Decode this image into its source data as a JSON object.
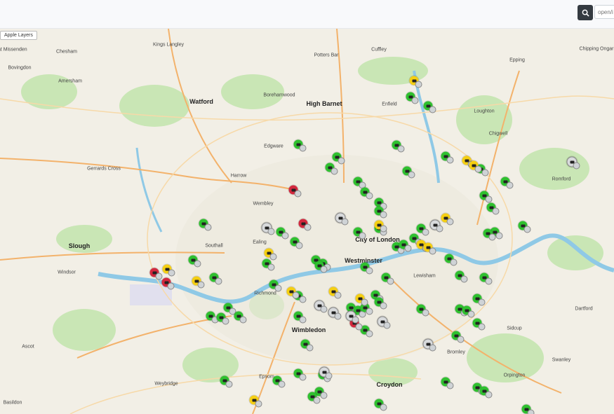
{
  "toolbar": {
    "search_placeholder": "open/i"
  },
  "map": {
    "layers_label": "Apple Layers",
    "places": [
      {
        "name": "Great Missenden"
      },
      {
        "name": "Chesham"
      },
      {
        "name": "Kings Langley"
      },
      {
        "name": "Bovingdon"
      },
      {
        "name": "Potters Bar"
      },
      {
        "name": "Cuffley"
      },
      {
        "name": "Epping"
      },
      {
        "name": "Chipping Ongar"
      },
      {
        "name": "Amersham"
      },
      {
        "name": "Watford"
      },
      {
        "name": "High Barnet"
      },
      {
        "name": "Enfield"
      },
      {
        "name": "Loughton"
      },
      {
        "name": "Chigwell"
      },
      {
        "name": "Borehamwood"
      },
      {
        "name": "Edgware"
      },
      {
        "name": "Gerrards Cross"
      },
      {
        "name": "Harrow"
      },
      {
        "name": "Wembley"
      },
      {
        "name": "Romford"
      },
      {
        "name": "Slough"
      },
      {
        "name": "Southall"
      },
      {
        "name": "Ealing"
      },
      {
        "name": "Westminster"
      },
      {
        "name": "City of London"
      },
      {
        "name": "Windsor"
      },
      {
        "name": "Richmond"
      },
      {
        "name": "Lewisham"
      },
      {
        "name": "Dartford"
      },
      {
        "name": "Wimbledon"
      },
      {
        "name": "Sidcup"
      },
      {
        "name": "Orpington"
      },
      {
        "name": "Croydon"
      },
      {
        "name": "Ascot"
      },
      {
        "name": "Weybridge"
      },
      {
        "name": "Epsom"
      },
      {
        "name": "Swanley"
      },
      {
        "name": "Bromley"
      },
      {
        "name": "Basildon"
      }
    ],
    "marker_status_colors": {
      "green": "#2fc02f",
      "yellow": "#f5cf12",
      "red": "#d3283e",
      "grey": "#d8dadc"
    },
    "marker_counts": {
      "green": 70,
      "yellow": 14,
      "red": 5,
      "grey": 10
    },
    "marker_icon": "bus-icon"
  }
}
